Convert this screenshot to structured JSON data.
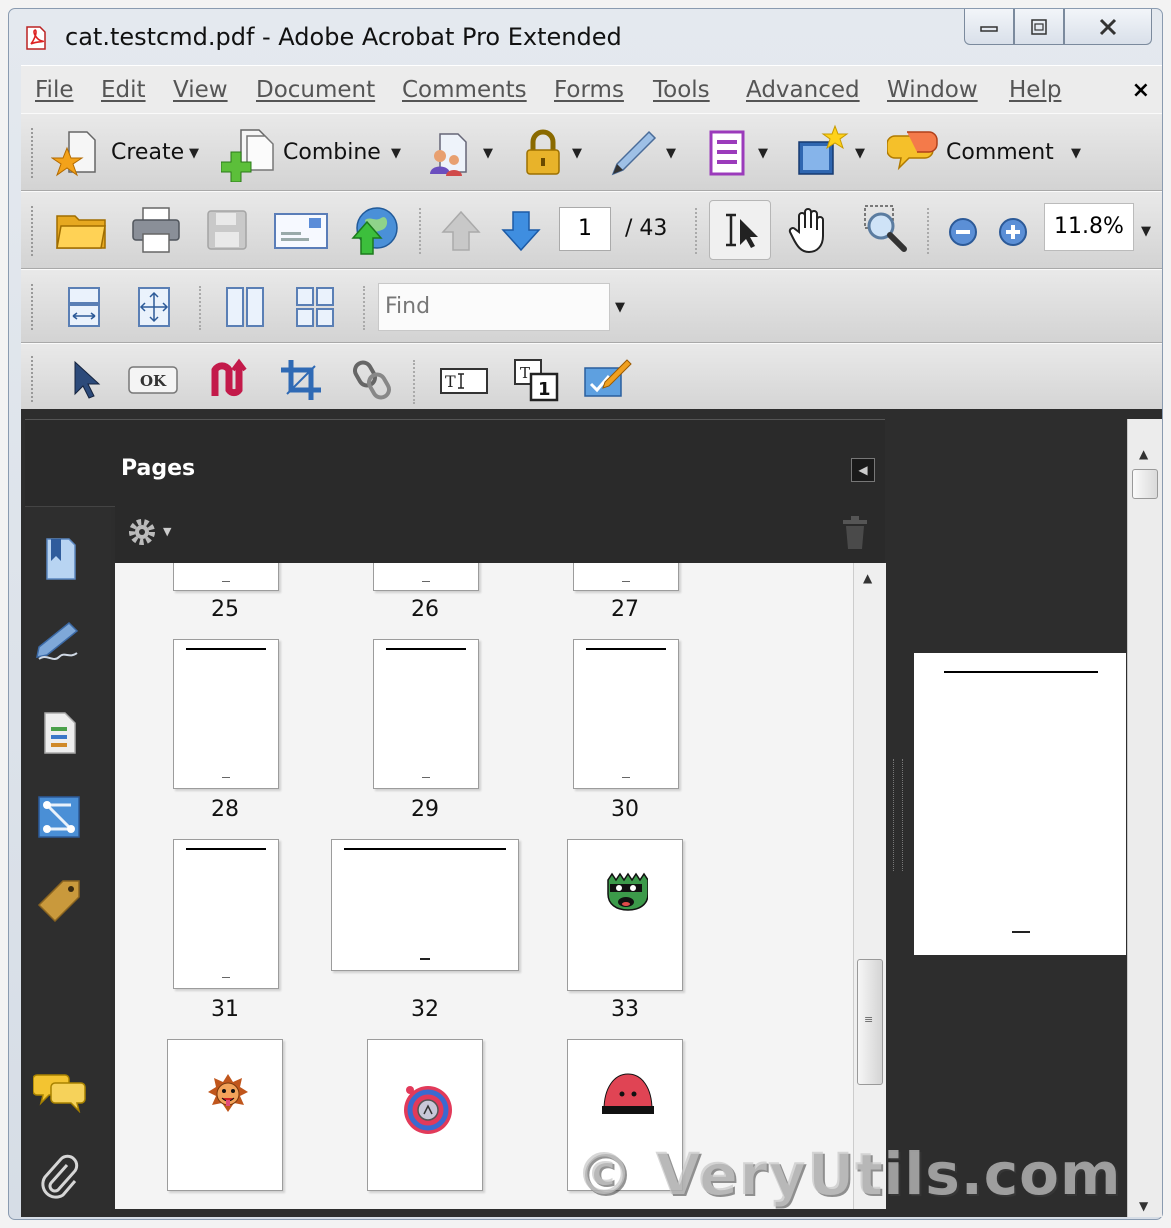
{
  "window": {
    "title": "cat.testcmd.pdf - Adobe Acrobat Pro Extended"
  },
  "menu": {
    "items": [
      "File",
      "Edit",
      "View",
      "Document",
      "Comments",
      "Forms",
      "Tools",
      "Advanced",
      "Window",
      "Help"
    ],
    "close": "×"
  },
  "toolbar1": {
    "create": "Create",
    "combine": "Combine",
    "comment": "Comment"
  },
  "nav": {
    "page_current": "1",
    "page_total": "/ 43",
    "zoom": "11.8%"
  },
  "find": {
    "placeholder": "Find"
  },
  "toolbar3": {
    "ok": "OK"
  },
  "pages_panel": {
    "title": "Pages",
    "labels": [
      "25",
      "26",
      "27",
      "28",
      "29",
      "30",
      "31",
      "32",
      "33"
    ]
  },
  "watermark": "© VeryUtils.com"
}
